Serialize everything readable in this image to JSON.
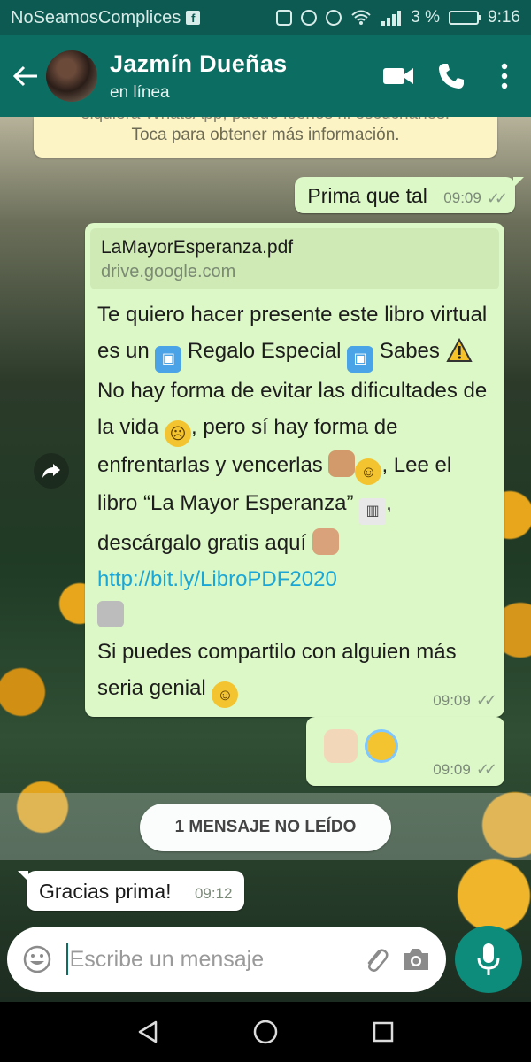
{
  "status_bar": {
    "carrier": "NoSeamosComplices",
    "battery_text": "3 %",
    "time": "9:16",
    "icons": [
      "facebook-icon",
      "vibrate-icon",
      "alarm-icon",
      "eye-icon",
      "wifi-icon",
      "signal-icon",
      "battery-icon"
    ]
  },
  "header": {
    "contact_name": "Jazmín Dueñas",
    "contact_status": "en línea",
    "colors": {
      "bar": "#0c6e62",
      "status_bar": "#0c5a52"
    }
  },
  "info_banner": {
    "partial_text": "siquiera WhatsApp, puede leerlos ni escucharlos.",
    "text": "Toca para obtener más información."
  },
  "messages": [
    {
      "type": "outgoing",
      "text": "Prima que tal",
      "time": "09:09",
      "ticks": "✓✓"
    },
    {
      "type": "outgoing",
      "link_card": {
        "title": "LaMayorEsperanza.pdf",
        "domain": "drive.google.com"
      },
      "segments": {
        "s1": "Te quiero hacer presente este libro virtual es un ",
        "s2": " Regalo Especial ",
        "s3": " Sabes ",
        "s4": " No hay forma de evitar las dificultades de la vida ",
        "s5": ", pero sí hay forma de enfrentarlas y vencerlas ",
        "s6": ",  Lee el libro “La Mayor Esperanza” ",
        "s7": ", descárgalo gratis aquí ",
        "link": "http://bit.ly/LibroPDF2020",
        "s8": "Si puedes compartilo con alguien más seria genial "
      },
      "emoji_icons": [
        "gift-emoji",
        "warning-emoji",
        "sad-face-emoji",
        "flexed-biceps-emoji",
        "smiling-face-emoji",
        "open-book-emoji",
        "pointing-finger-emoji",
        "technologist-emoji",
        "smiling-eyes-emoji"
      ],
      "time": "09:09",
      "ticks": "✓✓"
    },
    {
      "type": "outgoing",
      "emoji_icons": [
        "victory-hand-emoji",
        "halo-face-emoji"
      ],
      "time": "09:09",
      "ticks": "✓✓"
    },
    {
      "type": "incoming",
      "text": "Gracias prima!",
      "time": "09:12"
    }
  ],
  "unread_divider": "1 MENSAJE NO LEÍDO",
  "composer": {
    "placeholder": "Escribe un mensaje"
  },
  "accent": "#0d8b7b"
}
